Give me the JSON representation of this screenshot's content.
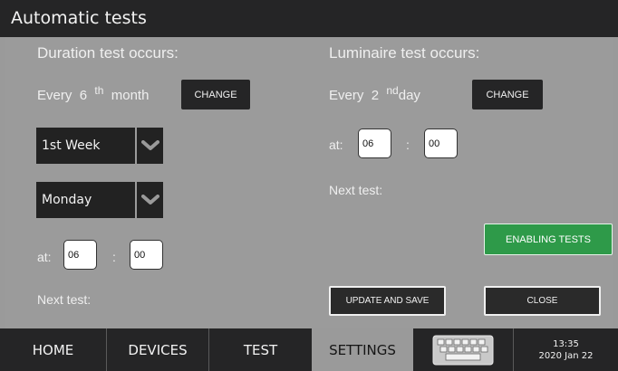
{
  "title": "Automatic tests",
  "duration": {
    "heading": "Duration test occurs:",
    "every_prefix": "Every",
    "every_number": "6",
    "every_suffix": "th",
    "every_unit": "month",
    "change_label": "CHANGE",
    "week_select": "1st Week",
    "day_select": "Monday",
    "at_label": "at:",
    "time_sep": ":",
    "hour": "06",
    "minute": "00",
    "next_test_label": "Next test:"
  },
  "luminaire": {
    "heading": "Luminaire test occurs:",
    "every_prefix": "Every",
    "every_number": "2",
    "every_suffix": "nd",
    "every_unit": "day",
    "change_label": "CHANGE",
    "at_label": "at:",
    "time_sep": ":",
    "hour": "06",
    "minute": "00",
    "next_test_label": "Next test:"
  },
  "buttons": {
    "enabling_tests": "ENABLING TESTS",
    "update_and_save": "UPDATE AND SAVE",
    "close": "CLOSE"
  },
  "nav": {
    "tabs": [
      "HOME",
      "DEVICES",
      "TEST",
      "SETTINGS"
    ],
    "active_tab": "SETTINGS",
    "keyboard_icon": "keyboard-icon",
    "time": "13:35",
    "date": "2020 Jan 22"
  },
  "colors": {
    "background": "#9b9b9b",
    "dark": "#252526",
    "accent_green": "#2e9a49"
  }
}
